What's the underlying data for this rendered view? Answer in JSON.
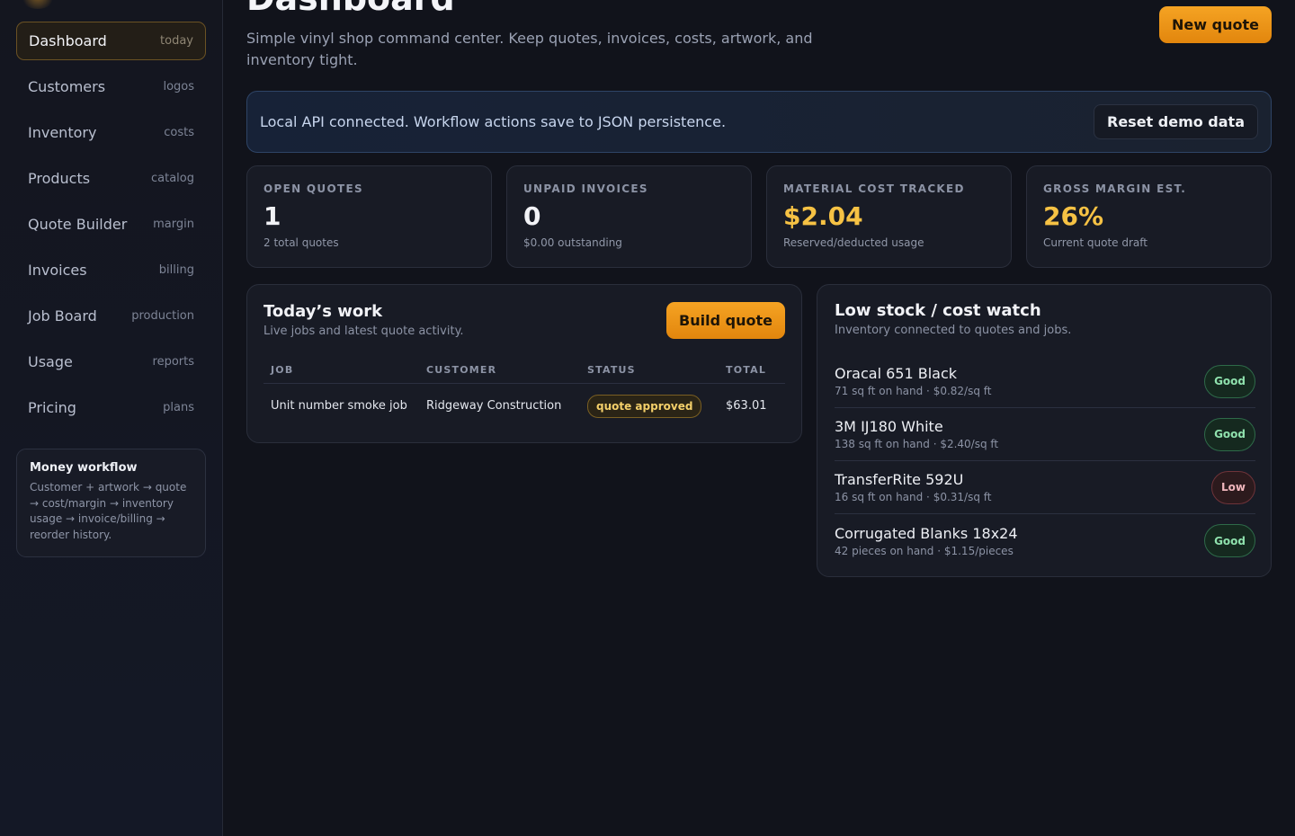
{
  "sidebar": {
    "items": [
      {
        "label": "Dashboard",
        "hint": "today"
      },
      {
        "label": "Customers",
        "hint": "logos"
      },
      {
        "label": "Inventory",
        "hint": "costs"
      },
      {
        "label": "Products",
        "hint": "catalog"
      },
      {
        "label": "Quote Builder",
        "hint": "margin"
      },
      {
        "label": "Invoices",
        "hint": "billing"
      },
      {
        "label": "Job Board",
        "hint": "production"
      },
      {
        "label": "Usage",
        "hint": "reports"
      },
      {
        "label": "Pricing",
        "hint": "plans"
      }
    ],
    "workflow": {
      "title": "Money workflow",
      "text": "Customer + artwork → quote → cost/margin → inventory usage → invoice/billing → reorder history."
    }
  },
  "header": {
    "title": "Dashboard",
    "subtitle": "Simple vinyl shop command center. Keep quotes, invoices, costs, artwork, and inventory tight.",
    "new_quote_label": "New quote"
  },
  "banner": {
    "text": "Local API connected. Workflow actions save to JSON persistence.",
    "reset_label": "Reset demo data"
  },
  "stats": [
    {
      "label": "OPEN QUOTES",
      "value": "1",
      "sub": "2 total quotes"
    },
    {
      "label": "UNPAID INVOICES",
      "value": "0",
      "sub": "$0.00 outstanding"
    },
    {
      "label": "MATERIAL COST TRACKED",
      "value": "$2.04",
      "sub": "Reserved/deducted usage"
    },
    {
      "label": "GROSS MARGIN EST.",
      "value": "26%",
      "sub": "Current quote draft"
    }
  ],
  "todays_work": {
    "title": "Today’s work",
    "subtitle": "Live jobs and latest quote activity.",
    "build_label": "Build quote",
    "columns": [
      "JOB",
      "CUSTOMER",
      "STATUS",
      "TOTAL"
    ],
    "rows": [
      {
        "job": "Unit number smoke job",
        "customer": "Ridgeway Construction",
        "status": "quote approved",
        "total": "$63.01"
      }
    ]
  },
  "stock": {
    "title": "Low stock / cost watch",
    "subtitle": "Inventory connected to quotes and jobs.",
    "items": [
      {
        "name": "Oracal 651 Black",
        "meta": "71 sq ft on hand · $0.82/sq ft",
        "badge": "Good"
      },
      {
        "name": "3M IJ180 White",
        "meta": "138 sq ft on hand · $2.40/sq ft",
        "badge": "Good"
      },
      {
        "name": "TransferRite 592U",
        "meta": "16 sq ft on hand · $0.31/sq ft",
        "badge": "Low"
      },
      {
        "name": "Corrugated Blanks 18x24",
        "meta": "42 pieces on hand · $1.15/pieces",
        "badge": "Good"
      }
    ]
  },
  "colors": {
    "accent": "#f5a323",
    "accent_value": "#f6c244",
    "good": "#8fe1ad",
    "low": "#f0b6bc"
  }
}
